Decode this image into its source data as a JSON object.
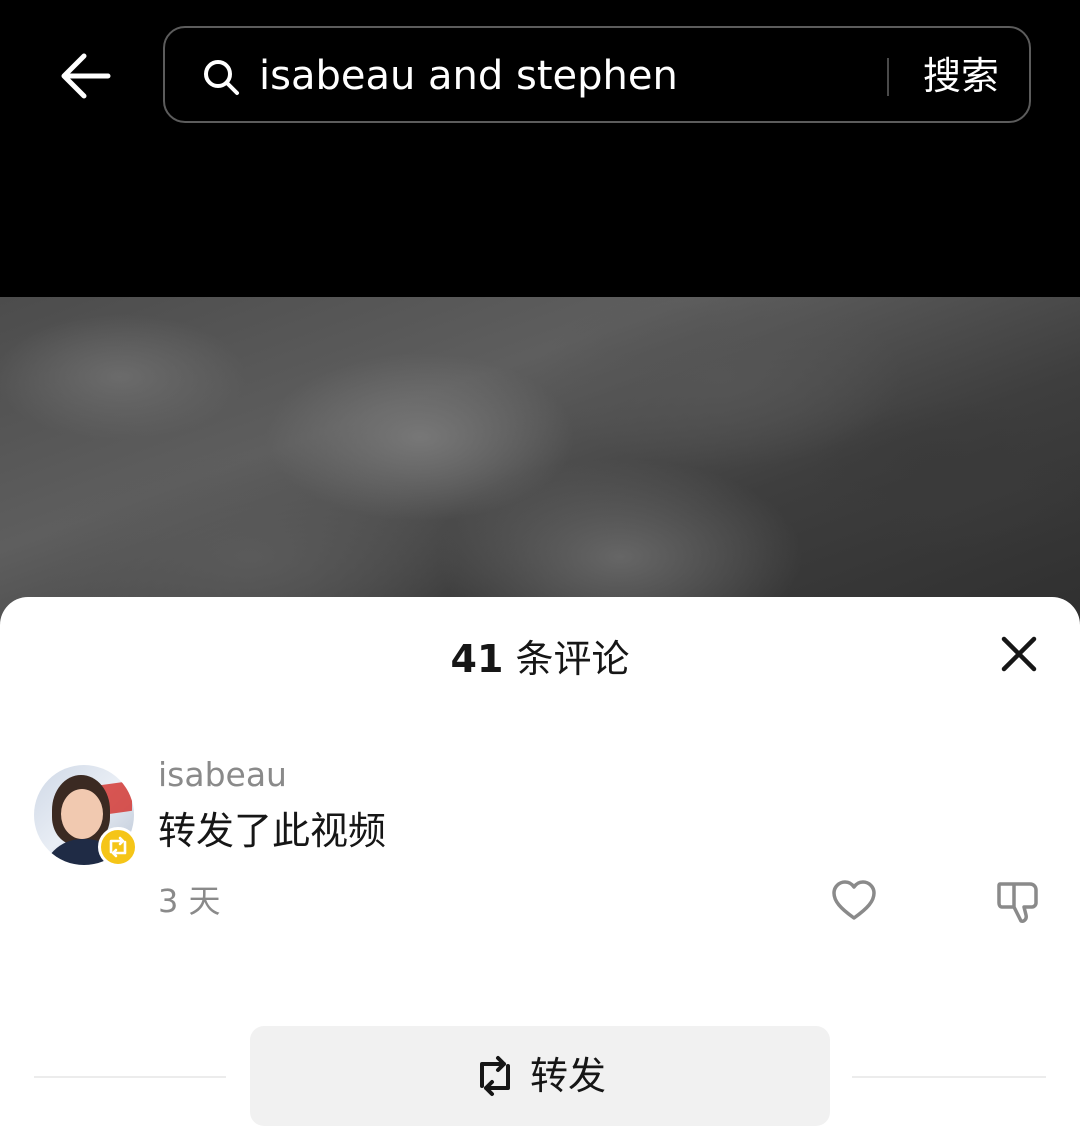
{
  "header": {
    "search_query": "isabeau and stephen",
    "search_button_label": "搜索"
  },
  "comments_panel": {
    "count": "41",
    "count_suffix": " 条评论",
    "comments": [
      {
        "username": "isabeau",
        "text": "转发了此视频",
        "time": "3 天"
      }
    ],
    "repost_button_label": "转发"
  },
  "colors": {
    "background": "#000000",
    "sheet": "#ffffff",
    "badge": "#f5c518",
    "muted_text": "#8a8a8a"
  },
  "icons": [
    "back-arrow-icon",
    "search-icon",
    "close-icon",
    "repost-icon",
    "heart-icon",
    "dislike-icon"
  ]
}
